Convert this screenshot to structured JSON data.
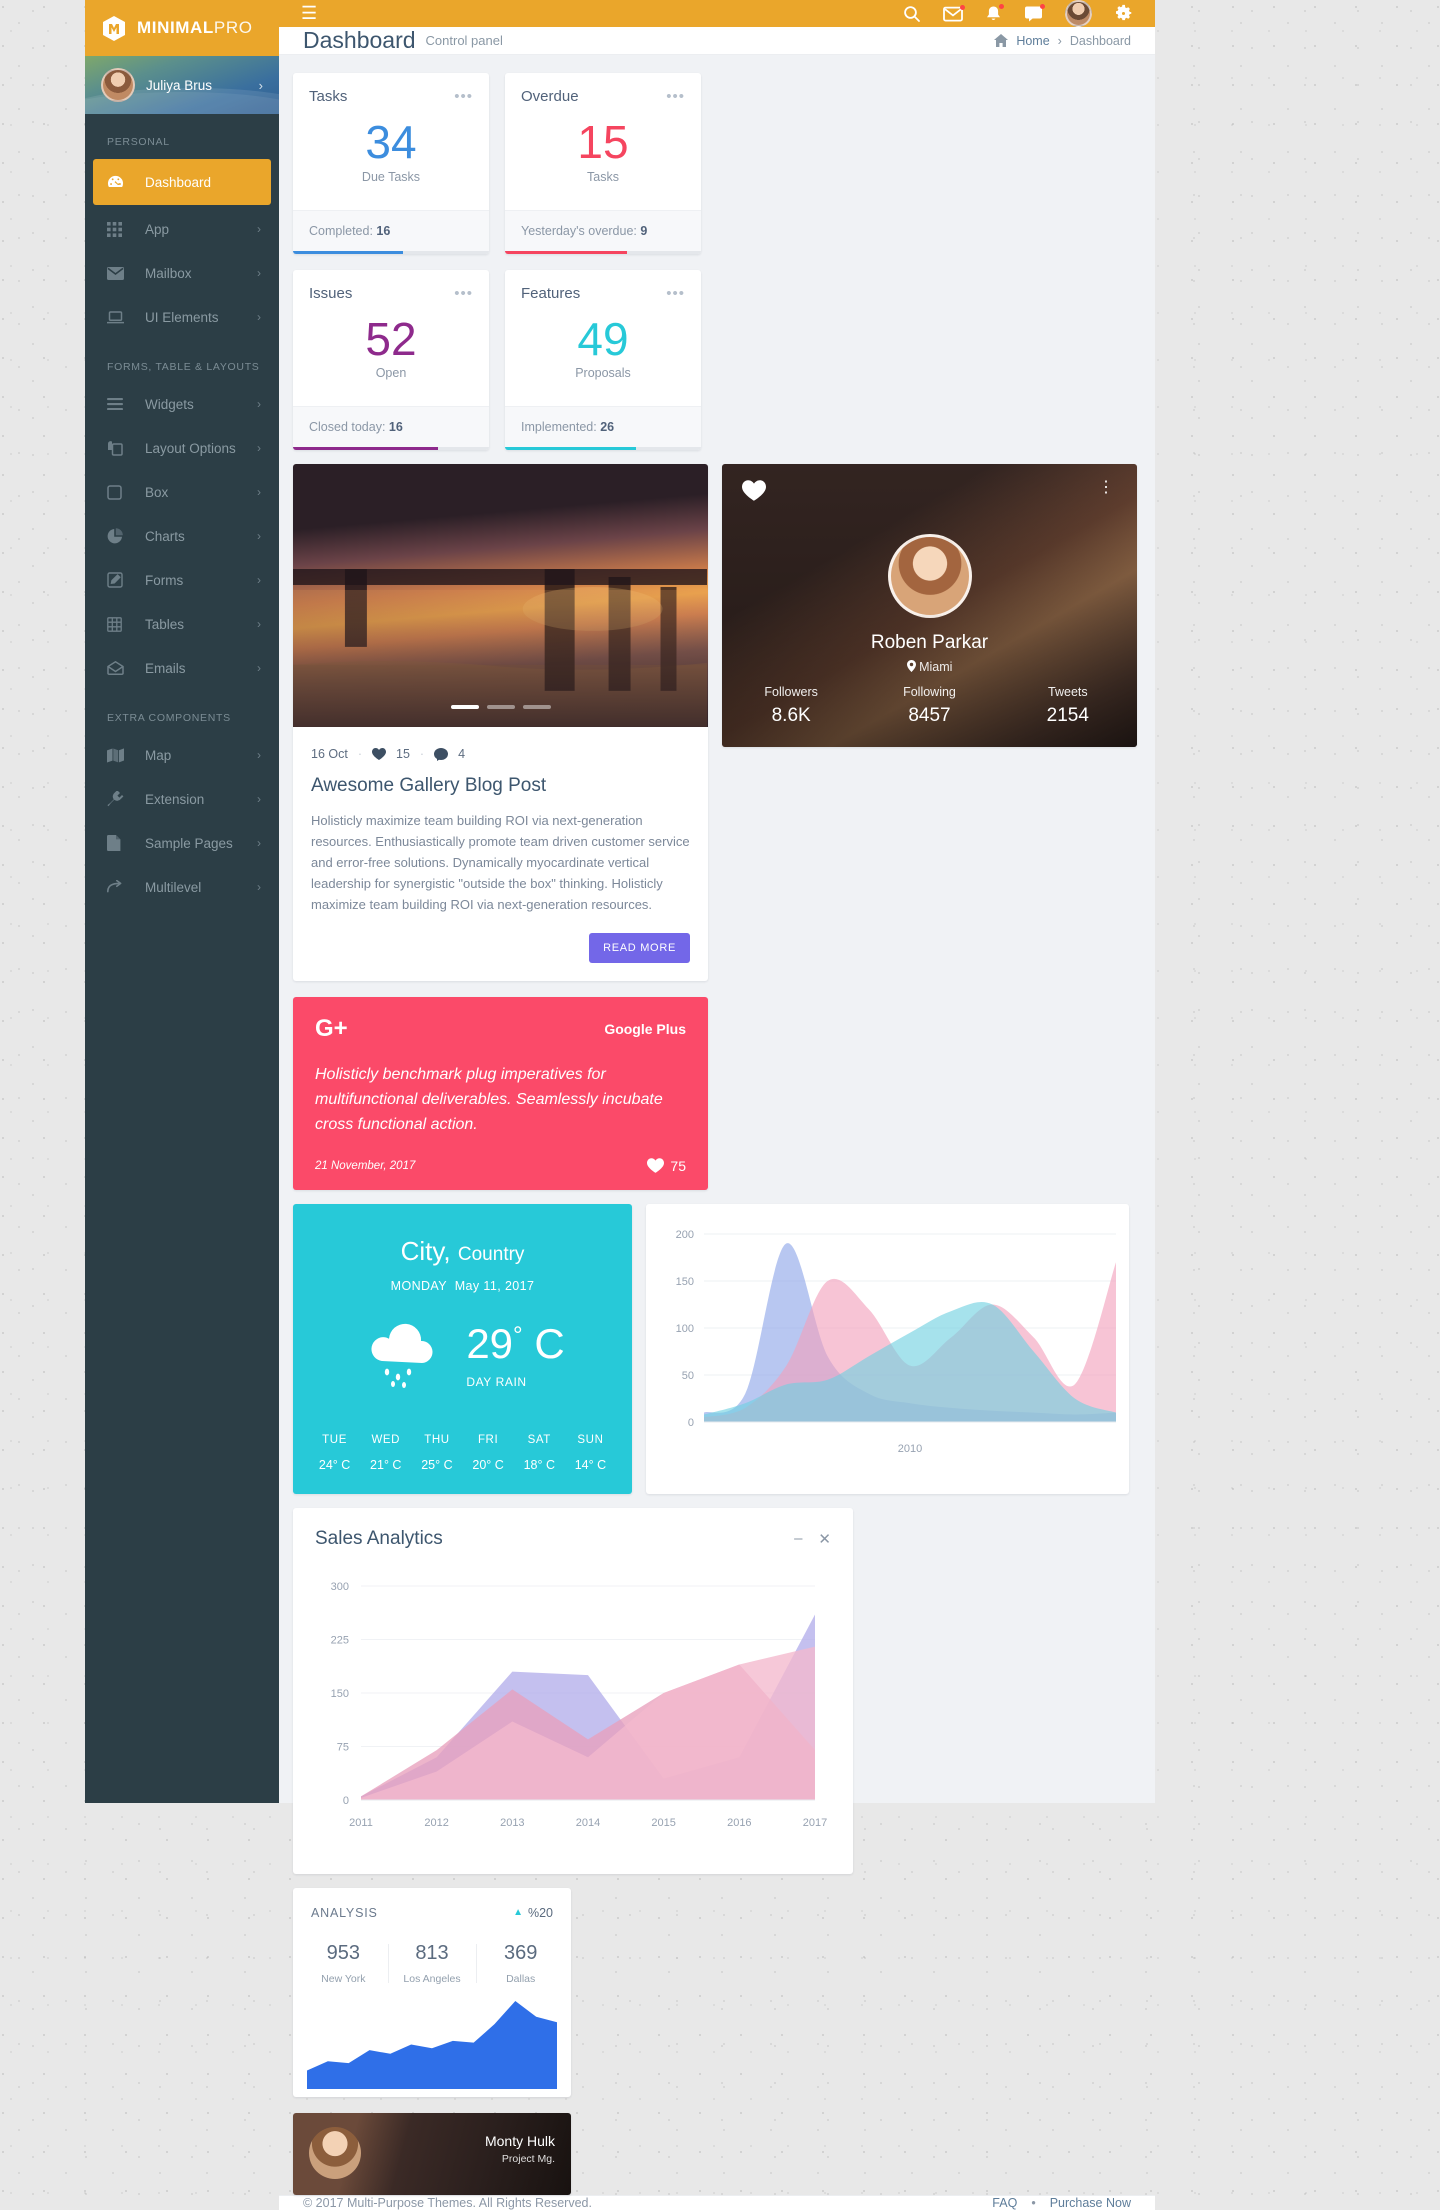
{
  "brand": {
    "bold": "MINIMAL",
    "light": "PRO",
    "logo_icon": "hexagon-m-logo"
  },
  "user": {
    "name": "Juliya Brus",
    "caret": "›"
  },
  "topbar": {
    "menu_icon": "hamburger-icon",
    "icons": [
      "search-icon",
      "envelope-icon",
      "bell-icon",
      "chat-icon",
      "avatar",
      "gear-icon"
    ]
  },
  "page": {
    "title": "Dashboard",
    "subtitle": "Control panel",
    "breadcrumb_home": "Home",
    "breadcrumb_sep": "›",
    "breadcrumb_current": "Dashboard"
  },
  "sidebar": {
    "sections": [
      {
        "label": "PERSONAL",
        "items": [
          {
            "label": "Dashboard",
            "icon": "dashboard-icon",
            "active": true,
            "caret": ""
          },
          {
            "label": "App",
            "icon": "grid-icon",
            "active": false,
            "caret": "›"
          },
          {
            "label": "Mailbox",
            "icon": "envelope-icon",
            "active": false,
            "caret": "›"
          },
          {
            "label": "UI Elements",
            "icon": "laptop-icon",
            "active": false,
            "caret": "›"
          }
        ]
      },
      {
        "label": "FORMS, TABLE & LAYOUTS",
        "items": [
          {
            "label": "Widgets",
            "icon": "list-icon",
            "active": false,
            "caret": "›"
          },
          {
            "label": "Layout Options",
            "icon": "copy-icon",
            "active": false,
            "caret": "›"
          },
          {
            "label": "Box",
            "icon": "square-icon",
            "active": false,
            "caret": "›"
          },
          {
            "label": "Charts",
            "icon": "pie-chart-icon",
            "active": false,
            "caret": "›"
          },
          {
            "label": "Forms",
            "icon": "pencil-square-icon",
            "active": false,
            "caret": "›"
          },
          {
            "label": "Tables",
            "icon": "table-icon",
            "active": false,
            "caret": "›"
          },
          {
            "label": "Emails",
            "icon": "open-envelope-icon",
            "active": false,
            "caret": "›"
          }
        ]
      },
      {
        "label": "EXTRA COMPONENTS",
        "items": [
          {
            "label": "Map",
            "icon": "map-icon",
            "active": false,
            "caret": "›"
          },
          {
            "label": "Extension",
            "icon": "plug-icon",
            "active": false,
            "caret": "›"
          },
          {
            "label": "Sample Pages",
            "icon": "file-icon",
            "active": false,
            "caret": "›"
          },
          {
            "label": "Multilevel",
            "icon": "arrow-branch-icon",
            "active": false,
            "caret": "›"
          }
        ]
      }
    ]
  },
  "stats": [
    {
      "title": "Tasks",
      "value": "34",
      "sub": "Due Tasks",
      "foot_label": "Completed:",
      "foot_value": "16",
      "color": "#3c8dde",
      "progress": 56,
      "dots": "•••"
    },
    {
      "title": "Overdue",
      "value": "15",
      "sub": "Tasks",
      "foot_label": "Yesterday's overdue:",
      "foot_value": "9",
      "color": "#f5455f",
      "progress": 62,
      "dots": "•••"
    },
    {
      "title": "Issues",
      "value": "52",
      "sub": "Open",
      "foot_label": "Closed today:",
      "foot_value": "16",
      "color": "#8e2a8c",
      "progress": 74,
      "dots": "•••"
    },
    {
      "title": "Features",
      "value": "49",
      "sub": "Proposals",
      "foot_label": "Implemented:",
      "foot_value": "26",
      "color": "#27c9d8",
      "progress": 67,
      "dots": "•••"
    }
  ],
  "blog": {
    "date": "16 Oct",
    "likes": "15",
    "comments": "4",
    "heart_icon": "heart-icon",
    "comment_icon": "comment-icon",
    "title": "Awesome Gallery Blog Post",
    "text": "Holisticly maximize team building ROI via next-generation resources. Enthusiastically promote team driven customer service and error-free solutions. Dynamically myocardinate vertical leadership for synergistic \"outside the box\" thinking. Holisticly maximize team building ROI via next-generation resources.",
    "read_more": "READ MORE",
    "slide_count": 3,
    "active_slide": 0
  },
  "gplus": {
    "logo": "G+",
    "logo_icon": "google-plus-icon",
    "name": "Google Plus",
    "quote": "Holisticly benchmark plug imperatives for multifunctional deliverables. Seamlessly incubate cross functional action.",
    "date": "21 November, 2017",
    "likes": "75",
    "heart_icon": "heart-icon",
    "color": "#fb4a69"
  },
  "profile": {
    "name": "Roben Parkar",
    "location": "Miami",
    "location_icon": "map-pin-icon",
    "heart_icon": "heart-icon",
    "menu_icon": "kebab-menu-icon",
    "stats": [
      {
        "key": "Followers",
        "value": "8.6K"
      },
      {
        "key": "Following",
        "value": "8457"
      },
      {
        "key": "Tweets",
        "value": "2154"
      }
    ]
  },
  "weather": {
    "city": "City,",
    "country": "Country",
    "day": "MONDAY",
    "date": "May 11, 2017",
    "temp": "29",
    "degree": "°",
    "unit": "C",
    "condition": "DAY RAIN",
    "icon": "rain-cloud-icon",
    "color": "#27c9d8",
    "forecast": [
      {
        "day": "TUE",
        "temp": "24° C"
      },
      {
        "day": "WED",
        "temp": "21° C"
      },
      {
        "day": "THU",
        "temp": "25° C"
      },
      {
        "day": "FRI",
        "temp": "20° C"
      },
      {
        "day": "SAT",
        "temp": "18° C"
      },
      {
        "day": "SUN",
        "temp": "14° C"
      }
    ]
  },
  "sales": {
    "title": "Sales Analytics",
    "minimize_icon": "minimize-icon",
    "close_icon": "close-icon"
  },
  "analysis": {
    "title": "ANALYSIS",
    "percent": "%20",
    "trend_icon": "caret-up-icon",
    "cities": [
      {
        "value": "953",
        "name": "New York"
      },
      {
        "value": "813",
        "name": "Los Angeles"
      },
      {
        "value": "369",
        "name": "Dallas"
      }
    ]
  },
  "monty": {
    "name": "Monty Hulk",
    "role": "Project Mg."
  },
  "footer": {
    "copyright": "© 2017 Multi-Purpose Themes. All Rights Reserved.",
    "faq": "FAQ",
    "sep": "•",
    "purchase": "Purchase Now"
  },
  "chart_data": [
    {
      "type": "area",
      "id": "top-area-chart",
      "title": "",
      "xlabel": "",
      "ylabel": "",
      "categories": [
        "2010"
      ],
      "x_tick_labels": [
        "2010"
      ],
      "y_tick_labels": [
        "0",
        "50",
        "100",
        "150",
        "200"
      ],
      "ylim": [
        0,
        200
      ],
      "grid": true,
      "legend": "none",
      "series": [
        {
          "name": "series-blue",
          "color": "#8da4e8",
          "values": [
            10,
            30,
            190,
            70,
            30,
            20,
            15,
            12,
            10,
            8,
            10
          ]
        },
        {
          "name": "series-pink",
          "color": "#f2a0bc",
          "values": [
            5,
            15,
            60,
            150,
            120,
            60,
            90,
            125,
            90,
            40,
            170
          ]
        },
        {
          "name": "series-cyan",
          "color": "#6fd0e0",
          "values": [
            8,
            20,
            40,
            45,
            70,
            95,
            118,
            125,
            75,
            25,
            10
          ]
        }
      ]
    },
    {
      "type": "area",
      "id": "sales-analytics-chart",
      "title": "Sales Analytics",
      "xlabel": "",
      "ylabel": "",
      "categories": [
        "2011",
        "2012",
        "2013",
        "2014",
        "2015",
        "2016",
        "2017"
      ],
      "x_tick_labels": [
        "2011",
        "2012",
        "2013",
        "2014",
        "2015",
        "2016",
        "2017"
      ],
      "y_tick_labels": [
        "0",
        "75",
        "150",
        "225",
        "300"
      ],
      "ylim": [
        0,
        300
      ],
      "grid": true,
      "legend": "none",
      "series": [
        {
          "name": "series-purple",
          "color": "#b3aeea",
          "values": [
            5,
            60,
            180,
            175,
            30,
            60,
            260
          ]
        },
        {
          "name": "series-pink",
          "color": "#e8a0bc",
          "values": [
            5,
            70,
            155,
            85,
            150,
            190,
            70
          ]
        },
        {
          "name": "series-rose",
          "color": "#f3b9cd",
          "values": [
            3,
            40,
            110,
            60,
            150,
            190,
            215
          ]
        }
      ]
    },
    {
      "type": "area",
      "id": "analysis-sparkline",
      "title": "",
      "xlabel": "",
      "ylabel": "",
      "categories": [],
      "y_tick_labels": [],
      "grid": false,
      "legend": "none",
      "series": [
        {
          "name": "analysis-trend",
          "color": "#2f6fe8",
          "values": [
            20,
            30,
            28,
            42,
            38,
            48,
            44,
            52,
            50,
            70,
            95,
            78,
            72
          ]
        }
      ]
    }
  ]
}
